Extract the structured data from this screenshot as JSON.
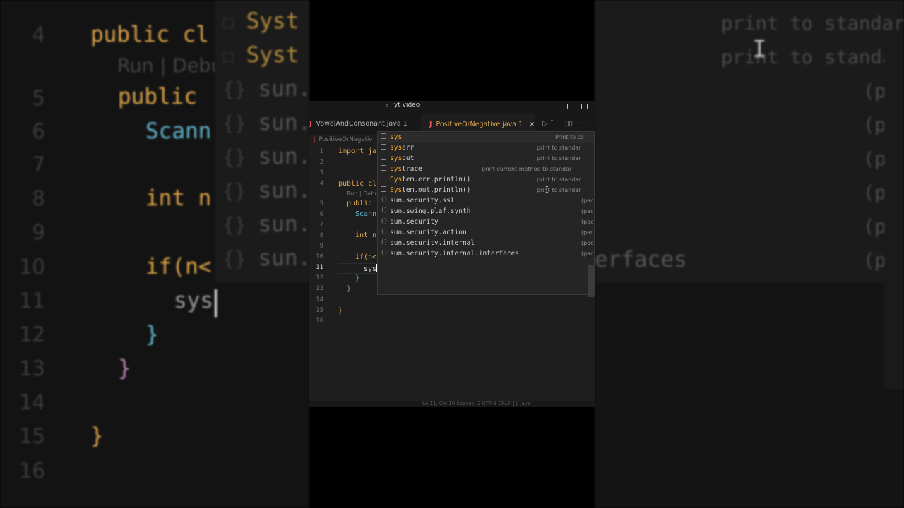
{
  "backdrop": {
    "gutter_numbers": [
      "4",
      "5",
      "6",
      "7",
      "8",
      "9",
      "10",
      "11",
      "12",
      "13",
      "14",
      "15",
      "16"
    ],
    "code_lines": [
      {
        "text": "public cl",
        "cls": "kw"
      },
      {
        "text": "Run | Debu",
        "cls": "lens"
      },
      {
        "text": "public",
        "cls": "kw"
      },
      {
        "text": "Scann",
        "cls": "tp"
      },
      {
        "text": "int n",
        "cls": "kw"
      },
      {
        "text": "if(n<",
        "cls": "kw"
      },
      {
        "text": "sys",
        "cls": "cur"
      },
      {
        "text": "}",
        "cls": "tp"
      },
      {
        "text": "}",
        "cls": "pl"
      },
      {
        "text": "}",
        "cls": "kw"
      }
    ],
    "suggest_labels": [
      "Syst",
      "Syst",
      "sun.",
      "sun.",
      "sun.",
      "sun.",
      "sun.",
      "sun."
    ],
    "right_hints": [
      "print to standar",
      "print to standar",
      "(pac",
      "(pac",
      "(pac",
      "(pac",
      "(pac",
      "(pac"
    ],
    "right_partial": "erfaces"
  },
  "window": {
    "title": "yt video",
    "tabs": [
      {
        "label": "VowelAndConsonant.java 1",
        "icon": "J"
      },
      {
        "label": "PositiveOrNegative.java 1",
        "icon": "J",
        "close": "×"
      }
    ],
    "breadcrumb": "PositiveOrNegativ",
    "breadcrumb_icon": "J",
    "line_numbers": [
      "1",
      "2",
      "3",
      "4",
      "5",
      "6",
      "7",
      "8",
      "9",
      "10",
      "11",
      "12",
      "13",
      "14",
      "15",
      "16"
    ],
    "code": {
      "import": "import ja",
      "class": "public cl",
      "codelens": "Run | Debu",
      "method": "public",
      "scanner": "Scann",
      "int": "int n",
      "if": "if(n<",
      "typed": "sys",
      "brace_inner": "}",
      "brace_method": "}",
      "brace_class": "}"
    },
    "status": "Ln 11, Col 10   Spaces: 2   UTF-8   CRLF   {} Java"
  },
  "suggestions": [
    {
      "label": "sys",
      "detail": "Print to co",
      "icon": "box",
      "selected": true
    },
    {
      "label": "syserr",
      "detail": "print to standar",
      "icon": "box"
    },
    {
      "label": "sysout",
      "detail": "print to standar",
      "icon": "box"
    },
    {
      "label": "systrace",
      "detail": "print current method to standar",
      "icon": "box"
    },
    {
      "label": "System.err.println()",
      "detail": "print to standar",
      "icon": "box"
    },
    {
      "label": "System.out.println()",
      "detail": "print to standar",
      "icon": "box"
    },
    {
      "label": "sun.security.ssl",
      "detail": "(pac",
      "icon": "brace"
    },
    {
      "label": "sun.swing.plaf.synth",
      "detail": "(pac",
      "icon": "brace"
    },
    {
      "label": "sun.security",
      "detail": "(pac",
      "icon": "brace"
    },
    {
      "label": "sun.security.action",
      "detail": "(pac",
      "icon": "brace"
    },
    {
      "label": "sun.security.internal",
      "detail": "(pac",
      "icon": "brace"
    },
    {
      "label": "sun.security.internal.interfaces",
      "detail": "(pac",
      "icon": "brace"
    }
  ],
  "colors": {
    "accent": "#e0a64a",
    "match": "#f5a623",
    "keyword": "#e0a64a",
    "type": "#62b6cf",
    "purple": "#c586c0"
  }
}
